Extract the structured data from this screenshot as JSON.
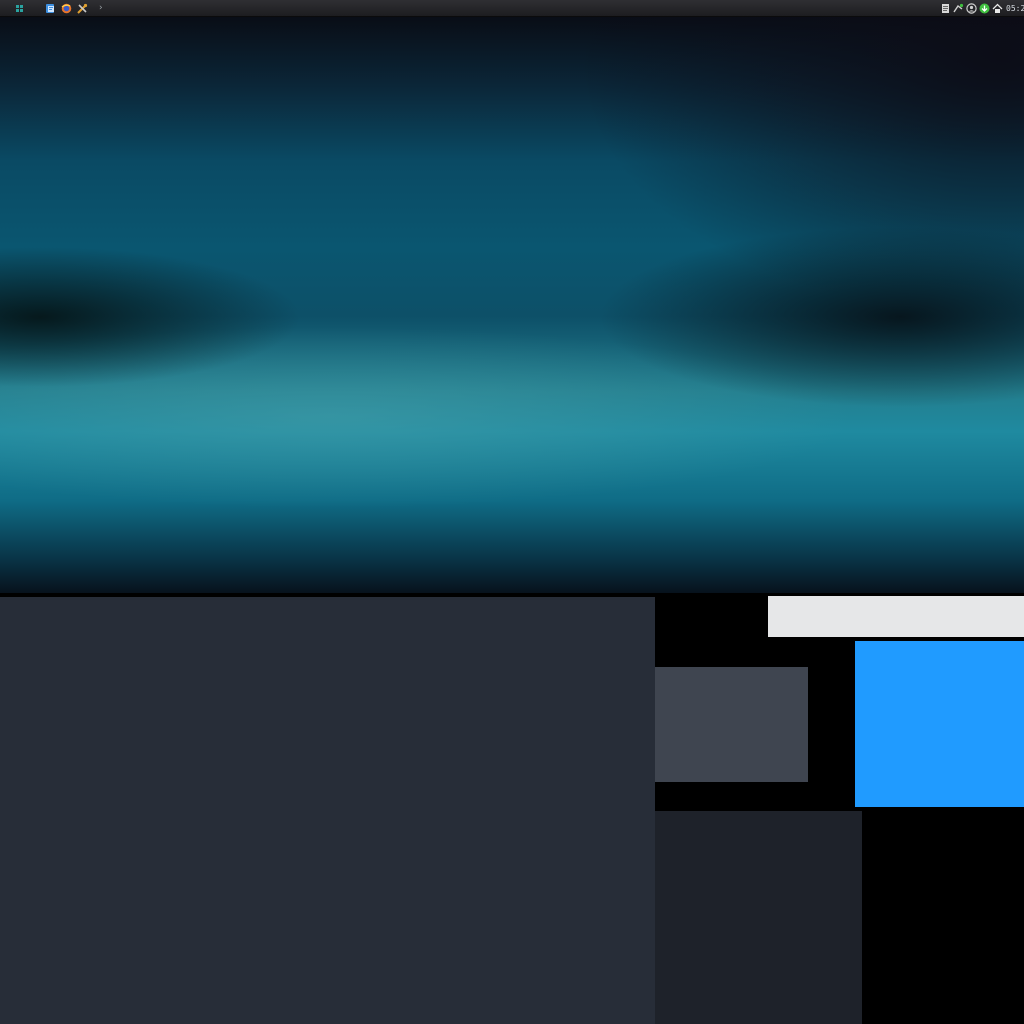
{
  "taskbar": {
    "launchers": [
      {
        "name": "app-menu-icon",
        "color": "#2aa3a0"
      },
      {
        "name": "file-manager-icon",
        "color": "#3d8fe0"
      },
      {
        "name": "web-browser-icon",
        "color": "#e8742a"
      },
      {
        "name": "tools-icon",
        "color": "#e0a030"
      }
    ],
    "overflow_arrow": "›",
    "tray": [
      {
        "name": "clipboard-icon"
      },
      {
        "name": "network-icon"
      },
      {
        "name": "user-icon"
      },
      {
        "name": "update-icon",
        "color": "#3fbf3f"
      },
      {
        "name": "home-icon"
      }
    ],
    "clock": "05:2"
  },
  "colors": {
    "panel_left": "#272d38",
    "panel_white": "#e6e7e8",
    "panel_grey": "#3f4550",
    "panel_blue": "#209bff",
    "panel_dark": "#1e222a"
  }
}
